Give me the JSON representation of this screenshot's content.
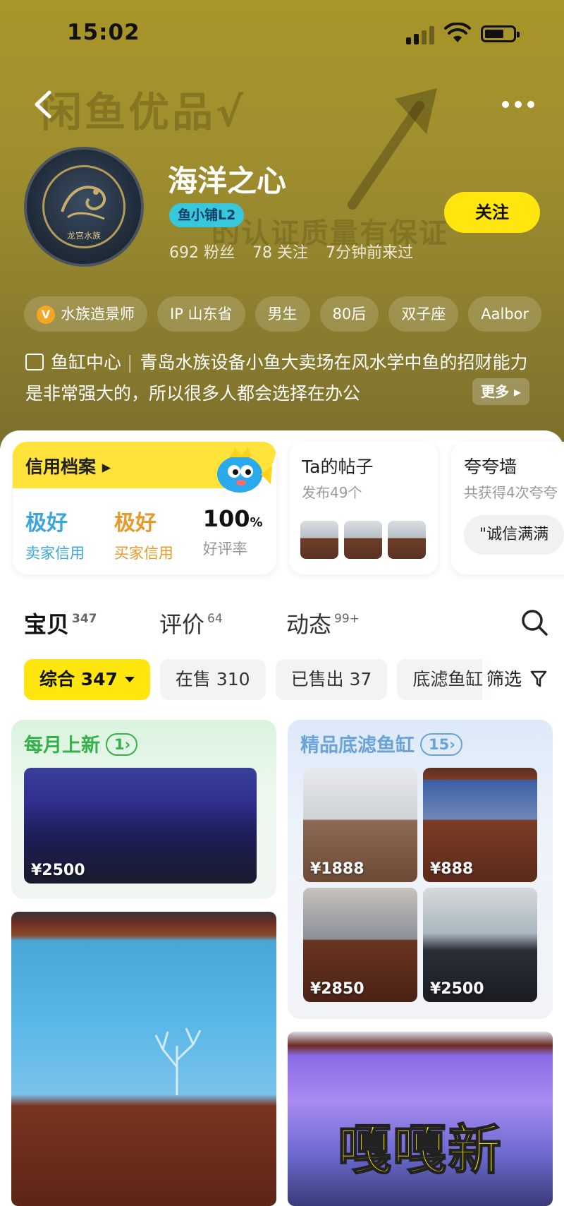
{
  "status_bar": {
    "time": "15:02"
  },
  "header": {
    "watermark_line1": "闲鱼优品√",
    "watermark_line2": "的认证质量有保证",
    "shop_name": "海洋之心",
    "level_badge": "鱼小铺L2",
    "fans": "692 粉丝",
    "following": "78 关注",
    "last_seen": "7分钟前来过",
    "follow_label": "关注",
    "avatar_text": "龙宫水族"
  },
  "tags": [
    {
      "label": "水族造景师",
      "badge": "V"
    },
    {
      "label": "IP 山东省"
    },
    {
      "label": "男生"
    },
    {
      "label": "80后"
    },
    {
      "label": "双子座"
    },
    {
      "label": "Aalbor"
    }
  ],
  "description": {
    "category": "鱼缸中心",
    "text": "青岛水族设备小鱼大卖场在风水学中鱼的招财能力是非常强大的，所以很多人都会选择在办公",
    "more_label": "更多"
  },
  "cards": {
    "credit": {
      "title": "信用档案",
      "items": [
        {
          "value": "极好",
          "label": "卖家信用"
        },
        {
          "value": "极好",
          "label": "买家信用"
        },
        {
          "value": "100",
          "unit": "%",
          "label": "好评率"
        }
      ]
    },
    "posts": {
      "title": "Ta的帖子",
      "subtitle": "发布49个"
    },
    "praise": {
      "title": "夸夸墙",
      "subtitle": "共获得4次夸夸",
      "quote": "\"诚信满满"
    }
  },
  "tabs": [
    {
      "label": "宝贝",
      "count": "347",
      "active": true
    },
    {
      "label": "评价",
      "count": "64"
    },
    {
      "label": "动态",
      "count": "99+"
    }
  ],
  "filters": {
    "chips": [
      {
        "label": "综合 347",
        "active": true
      },
      {
        "label": "在售 310"
      },
      {
        "label": "已售出 37"
      },
      {
        "label": "底滤鱼缸"
      }
    ],
    "filter_label": "筛选"
  },
  "groups": [
    {
      "title": "每月上新",
      "count": "1",
      "items": [
        {
          "price": "¥2500"
        }
      ]
    },
    {
      "title": "精品底滤鱼缸",
      "count": "15",
      "items": [
        {
          "price": "¥1888"
        },
        {
          "price": "¥888"
        },
        {
          "price": "¥2850"
        },
        {
          "price": "¥2500"
        }
      ]
    }
  ],
  "feature": {
    "overlay_text": "嘎嘎新"
  },
  "colors": {
    "brand_yellow": "#ffe60f",
    "header_olive": "#9f8e2e",
    "green_title": "#36b04a",
    "blue_title": "#6aa3d8"
  }
}
